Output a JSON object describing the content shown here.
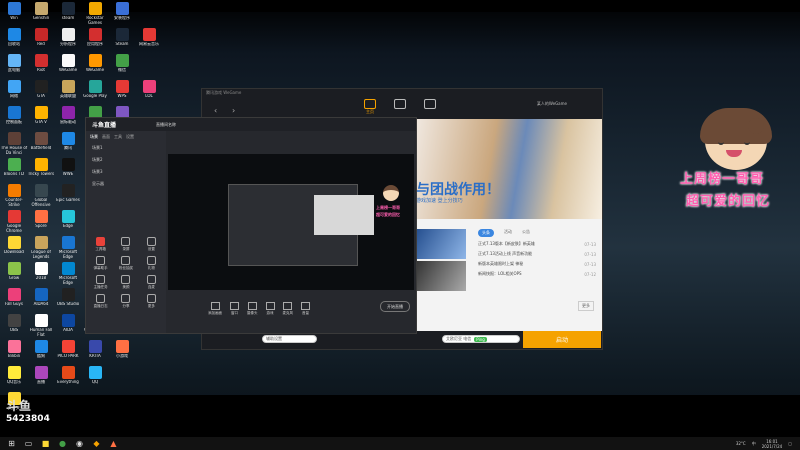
{
  "desktop": {
    "icons": [
      {
        "label": "Win",
        "color": "#2d78d6"
      },
      {
        "label": "Genshin",
        "color": "#c6a96e"
      },
      {
        "label": "steam",
        "color": "#1b2838"
      },
      {
        "label": "Rockstar Games",
        "color": "#f2a900"
      },
      {
        "label": "安装程序",
        "color": "#3a6fd8"
      },
      {
        "label": "回收站",
        "color": "#1e88e5"
      },
      {
        "label": "Red",
        "color": "#c62828"
      },
      {
        "label": "分析程序",
        "color": "#eeeeee"
      },
      {
        "label": "应用程序",
        "color": "#d32f2f"
      },
      {
        "label": "Steam",
        "color": "#1b2838"
      },
      {
        "label": "网易云音乐",
        "color": "#e53935"
      },
      {
        "label": "此电脑",
        "color": "#64b5f6"
      },
      {
        "label": "Riot",
        "color": "#d32f2f"
      },
      {
        "label": "WeGame",
        "color": "#fafafa"
      },
      {
        "label": "WeGame",
        "color": "#ff9800"
      },
      {
        "label": "微信",
        "color": "#43a047"
      },
      {
        "label": "网络",
        "color": "#42a5f5"
      },
      {
        "label": "GTA",
        "color": "#212121"
      },
      {
        "label": "英雄联盟",
        "color": "#c8a55b"
      },
      {
        "label": "Google Play",
        "color": "#26a69a"
      },
      {
        "label": "WPS",
        "color": "#e53935"
      },
      {
        "label": "LOL",
        "color": "#ec407a"
      },
      {
        "label": "控制面板",
        "color": "#1976d2"
      },
      {
        "label": "GTA V",
        "color": "#ffb300"
      },
      {
        "label": "鼠标驱动",
        "color": "#8e24aa"
      },
      {
        "label": "Chrome",
        "color": "#43a047"
      },
      {
        "label": "手机助手",
        "color": "#7e57c2"
      },
      {
        "label": "The House of Da Vinci",
        "color": "#5d4037"
      },
      {
        "label": "Battlefield",
        "color": "#6d4c41"
      },
      {
        "label": "腾讯",
        "color": "#1e88e5"
      },
      {
        "label": "Bloons TD",
        "color": "#4caf50"
      },
      {
        "label": "Tricky Towers",
        "color": "#ffb300"
      },
      {
        "label": "WWE",
        "color": "#111111"
      },
      {
        "label": "Counter-Strike",
        "color": "#f57c00"
      },
      {
        "label": "Global Offensive",
        "color": "#37474f"
      },
      {
        "label": "Epic Games",
        "color": "#222222"
      },
      {
        "label": "Google Chrome",
        "color": "#e53935"
      },
      {
        "label": "Spore",
        "color": "#ff7043"
      },
      {
        "label": "Edge",
        "color": "#26c6da"
      },
      {
        "label": "Download",
        "color": "#fdd835"
      },
      {
        "label": "League of Legends",
        "color": "#c9a45c"
      },
      {
        "label": "Microsoft Edge",
        "color": "#1976d2"
      },
      {
        "label": "Grow",
        "color": "#8bc34a"
      },
      {
        "label": "2018",
        "color": "#ffffff"
      },
      {
        "label": "Microsoft Edge",
        "color": "#0288d1"
      },
      {
        "label": "Fall Guys",
        "color": "#ec407a"
      },
      {
        "label": "AIDA64",
        "color": "#1565c0"
      },
      {
        "label": "OBS Studio",
        "color": "#212121"
      },
      {
        "label": "OBS",
        "color": "#424242"
      },
      {
        "label": "Human Fall Flat",
        "color": "#ffffff"
      },
      {
        "label": "AIDA",
        "color": "#0d47a1"
      },
      {
        "label": "Overwatch",
        "color": "#ff9800"
      },
      {
        "label": "Bilibili",
        "color": "#fb7299"
      },
      {
        "label": "酷狗",
        "color": "#1e88e5"
      },
      {
        "label": "PICO PARK",
        "color": "#f44336"
      },
      {
        "label": "KRITA",
        "color": "#3949ab"
      },
      {
        "label": "小游戏",
        "color": "#ff7043"
      },
      {
        "label": "QQ音乐",
        "color": "#ffeb3b"
      },
      {
        "label": "直播",
        "color": "#ab47bc"
      },
      {
        "label": "Everything",
        "color": "#e64a19"
      },
      {
        "label": "QQ",
        "color": "#29b6f6"
      },
      {
        "label": "文件夹",
        "color": "#fdd835"
      }
    ]
  },
  "watermark": {
    "logo": "斗鱼",
    "room": "5423804"
  },
  "launcher": {
    "title": "腾讯游戏 WeGame",
    "tabs": [
      {
        "label": "主页"
      },
      {
        "label": ""
      },
      {
        "label": ""
      }
    ],
    "user": "某人的WeGame",
    "banner_title": "与团战作用！",
    "banner_sub": "游戏加速 登上分技巧",
    "news_tabs": [
      "头条",
      "活动",
      "公告"
    ],
    "news": [
      {
        "text": "正式7.13版本【新皮肤】新英雄",
        "date": "07-13"
      },
      {
        "text": "正式7.13活动上线 声音新功能",
        "date": "07-13"
      },
      {
        "text": "新版本英雄限时上架 神秘",
        "date": "07-13"
      },
      {
        "text": "新闻快报：LOL相关OPS",
        "date": "07-12"
      }
    ],
    "more": "更多",
    "switch": "辅助设置",
    "server": "艾欧尼亚 电信",
    "server_tag": "Ping",
    "start": "启动"
  },
  "stream": {
    "logo": "斗鱼直播",
    "room": "直播间名称",
    "tabs": [
      "场景",
      "画面",
      "工具",
      "设置"
    ],
    "scenes": [
      "场景1",
      "场景2",
      "场景3",
      "显示器"
    ],
    "tools": [
      {
        "label": "工具箱"
      },
      {
        "label": "录屏"
      },
      {
        "label": "设置"
      },
      {
        "label": "弹幕助手"
      },
      {
        "label": "粉丝抽奖"
      },
      {
        "label": "礼物"
      },
      {
        "label": "主播任务"
      },
      {
        "label": "美颜"
      },
      {
        "label": "连麦"
      },
      {
        "label": "直播日志"
      },
      {
        "label": "分享"
      },
      {
        "label": "更多"
      }
    ],
    "controls": [
      {
        "label": "添加画面"
      },
      {
        "label": "窗口"
      },
      {
        "label": "摄像头"
      },
      {
        "label": "游戏"
      },
      {
        "label": "麦克风"
      },
      {
        "label": "音量"
      }
    ],
    "live": "开始直播"
  },
  "overlay": {
    "caption1": "上周榜一哥哥",
    "caption2": "超可爱的回忆",
    "mini1": "上周榜一哥哥",
    "mini2": "超可爱的回忆"
  },
  "taskbar": {
    "time": "16:01",
    "date": "2021/7/24",
    "lang": "中",
    "weather": "32°C"
  }
}
